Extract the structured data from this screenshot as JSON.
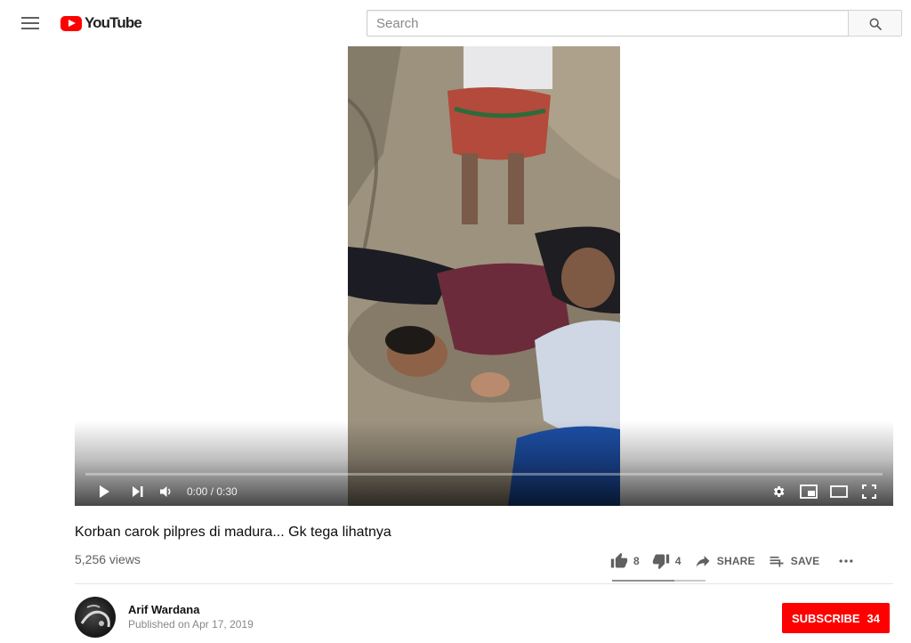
{
  "header": {
    "logo_text": "YouTube",
    "search_placeholder": "Search"
  },
  "player": {
    "current_time": "0:00",
    "duration": "0:30",
    "time_display": "0:00 / 0:30",
    "progress_fraction": 0.0
  },
  "video": {
    "title": "Korban carok pilpres di madura... Gk tega lihatnya",
    "views": "5,256 views",
    "likes": "8",
    "dislikes": "4",
    "share_label": "SHARE",
    "save_label": "SAVE",
    "like_fraction": 0.67
  },
  "owner": {
    "channel_name": "Arif Wardana",
    "published": "Published on Apr 17, 2019",
    "subscribe_label": "SUBSCRIBE",
    "subscriber_count": "34"
  },
  "colors": {
    "brand_red": "#ff0000",
    "icon_grey": "#606060"
  }
}
